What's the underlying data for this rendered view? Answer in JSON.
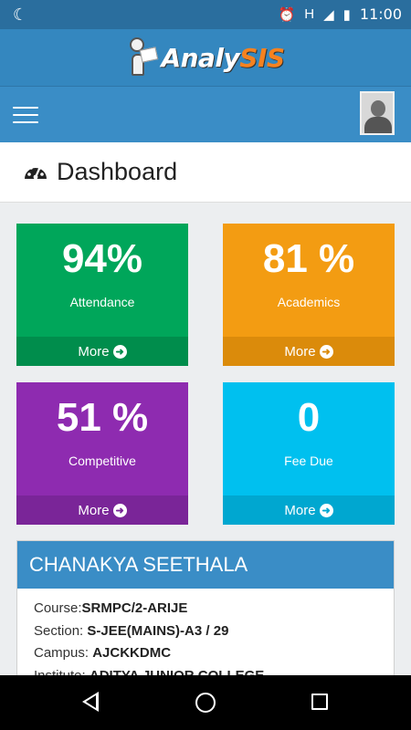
{
  "statusbar": {
    "time": "11:00",
    "network": "H",
    "icons": [
      "moon-icon",
      "alarm-icon",
      "signal-icon",
      "battery-icon"
    ]
  },
  "brand": {
    "part1": "Analy",
    "part2": "SIS"
  },
  "page": {
    "title": "Dashboard",
    "icon": "dashboard-gauge-icon"
  },
  "tiles": [
    {
      "value": "94%",
      "label": "Attendance",
      "more": "More",
      "color": "#00a65a"
    },
    {
      "value": "81 %",
      "label": "Academics",
      "more": "More",
      "color": "#f39c12"
    },
    {
      "value": "51 %",
      "label": "Competitive",
      "more": "More",
      "color": "#8e2bb0"
    },
    {
      "value": "0",
      "label": "Fee Due",
      "more": "More",
      "color": "#00c0ef"
    }
  ],
  "profile": {
    "name": "CHANAKYA SEETHALA",
    "rows": [
      {
        "label": "Course:",
        "value": "SRMPC/2-ARIJE"
      },
      {
        "label": "Section: ",
        "value": "S-JEE(MAINS)-A3 / 29"
      },
      {
        "label": "Campus: ",
        "value": "AJCKKDMC"
      },
      {
        "label": "Institute: ",
        "value": "ADITYA JUNIOR COLLEGE"
      }
    ]
  },
  "colors": {
    "header": "#3487bf",
    "navbar": "#3a8dc6",
    "accent": "#f58220"
  }
}
